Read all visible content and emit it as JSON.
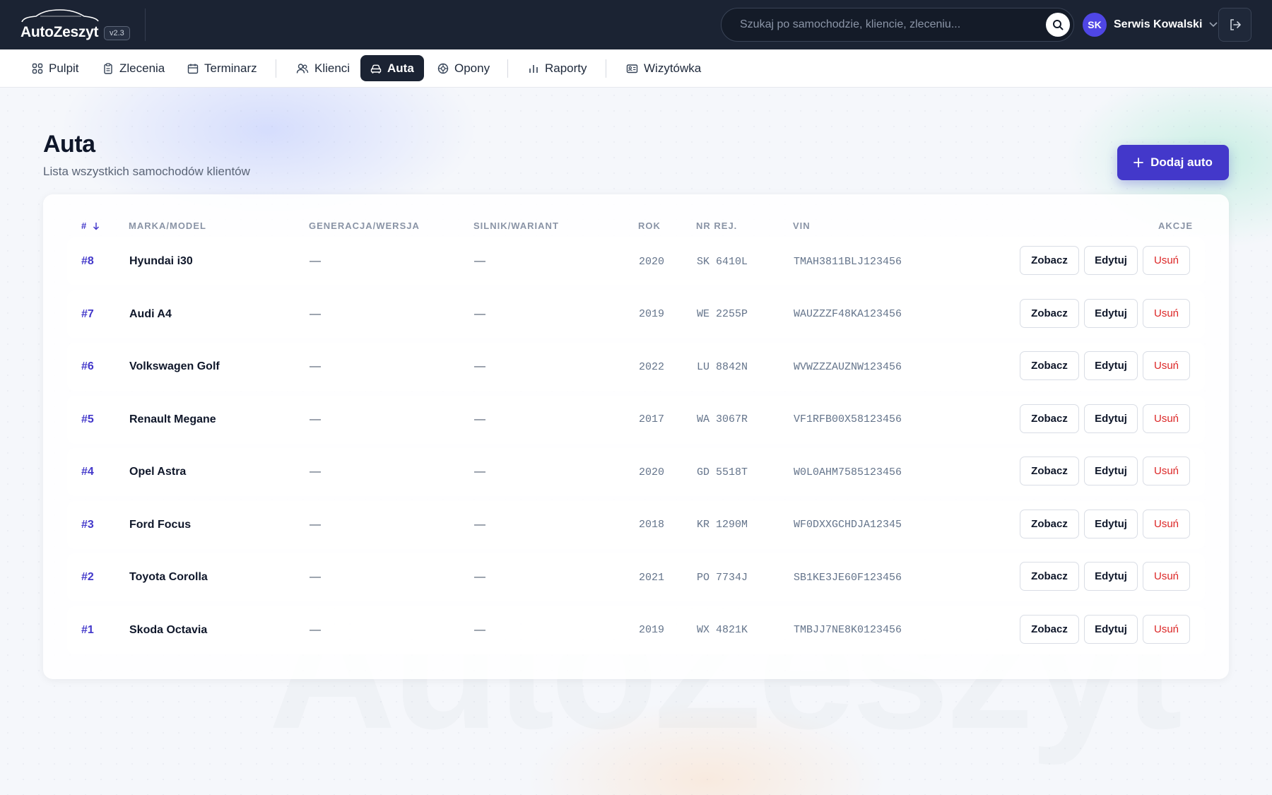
{
  "app": {
    "name": "AutoZeszyt",
    "version": "v2.3"
  },
  "search": {
    "placeholder": "Szukaj po samochodzie, kliencie, zleceniu..."
  },
  "user": {
    "initials": "SK",
    "name": "Serwis Kowalski"
  },
  "nav": {
    "items": [
      {
        "label": "Pulpit",
        "icon": "grid-icon"
      },
      {
        "label": "Zlecenia",
        "icon": "clipboard-icon"
      },
      {
        "label": "Terminarz",
        "icon": "calendar-icon"
      },
      {
        "label": "Klienci",
        "icon": "users-icon"
      },
      {
        "label": "Auta",
        "icon": "car-icon",
        "active": true
      },
      {
        "label": "Opony",
        "icon": "tire-icon"
      },
      {
        "label": "Raporty",
        "icon": "bar-chart-icon"
      },
      {
        "label": "Wizytówka",
        "icon": "id-card-icon"
      }
    ]
  },
  "page": {
    "title": "Auta",
    "subtitle": "Lista wszystkich samochodów klientów",
    "add_button": "Dodaj auto"
  },
  "table": {
    "headers": {
      "id": "#",
      "model": "MARKA/MODEL",
      "generation": "GENERACJA/WERSJA",
      "engine": "SILNIK/WARIANT",
      "year": "ROK",
      "plate": "NR REJ.",
      "vin": "VIN",
      "actions": "AKCJE"
    },
    "actions": {
      "view": "Zobacz",
      "edit": "Edytuj",
      "delete": "Usuń"
    },
    "rows": [
      {
        "id": "#8",
        "model": "Hyundai i30",
        "generation": "—",
        "engine": "—",
        "year": "2020",
        "plate": "SK 6410L",
        "vin": "TMAH3811BLJ123456"
      },
      {
        "id": "#7",
        "model": "Audi A4",
        "generation": "—",
        "engine": "—",
        "year": "2019",
        "plate": "WE 2255P",
        "vin": "WAUZZZF48KA123456"
      },
      {
        "id": "#6",
        "model": "Volkswagen Golf",
        "generation": "—",
        "engine": "—",
        "year": "2022",
        "plate": "LU 8842N",
        "vin": "WVWZZZAUZNW123456"
      },
      {
        "id": "#5",
        "model": "Renault Megane",
        "generation": "—",
        "engine": "—",
        "year": "2017",
        "plate": "WA 3067R",
        "vin": "VF1RFB00X58123456"
      },
      {
        "id": "#4",
        "model": "Opel Astra",
        "generation": "—",
        "engine": "—",
        "year": "2020",
        "plate": "GD 5518T",
        "vin": "W0L0AHM7585123456"
      },
      {
        "id": "#3",
        "model": "Ford Focus",
        "generation": "—",
        "engine": "—",
        "year": "2018",
        "plate": "KR 1290M",
        "vin": "WF0DXXGCHDJA12345"
      },
      {
        "id": "#2",
        "model": "Toyota Corolla",
        "generation": "—",
        "engine": "—",
        "year": "2021",
        "plate": "PO 7734J",
        "vin": "SB1KE3JE60F123456"
      },
      {
        "id": "#1",
        "model": "Skoda Octavia",
        "generation": "—",
        "engine": "—",
        "year": "2019",
        "plate": "WX 4821K",
        "vin": "TMBJJ7NE8K0123456"
      }
    ]
  },
  "colors": {
    "topbar": "#1b2333",
    "accent": "#4338ca",
    "danger": "#dc2626"
  },
  "watermark": "AutoZeszyt"
}
